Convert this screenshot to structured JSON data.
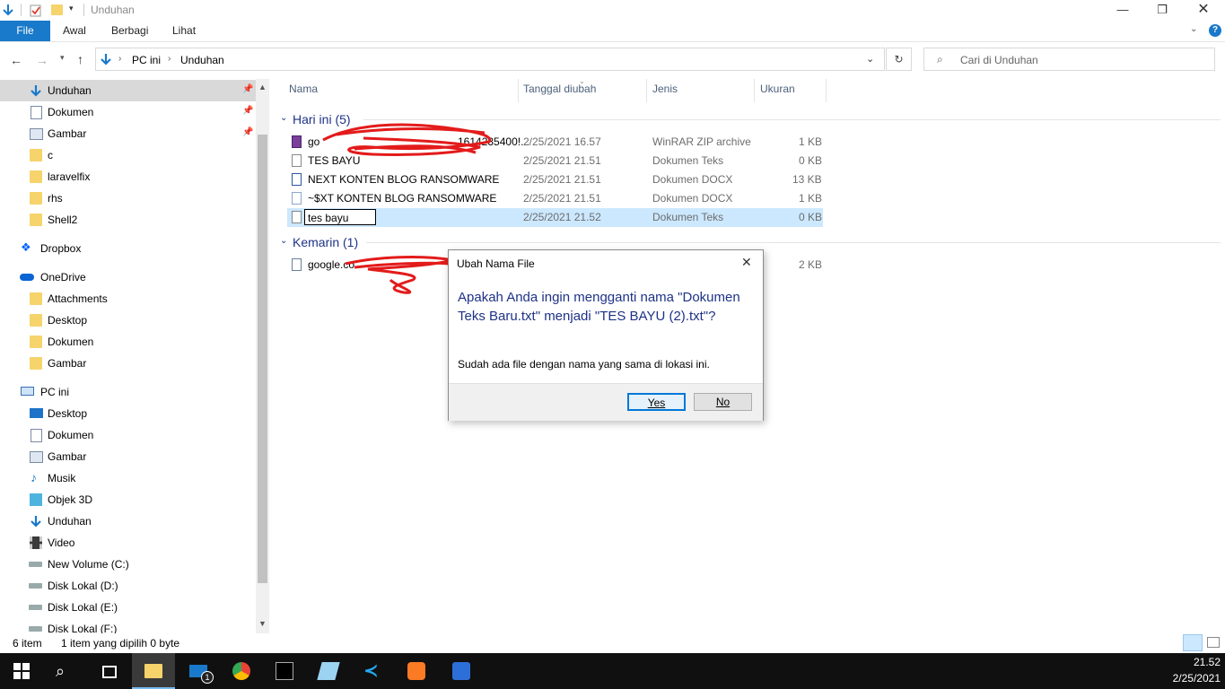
{
  "window": {
    "title": "Unduhan"
  },
  "ribbon": {
    "tabs": [
      "File",
      "Awal",
      "Berbagi",
      "Lihat"
    ]
  },
  "address": {
    "crumbs": [
      "PC ini",
      "Unduhan"
    ],
    "search_placeholder": "Cari di Unduhan"
  },
  "nav": {
    "quick_access": [
      "Unduhan",
      "Dokumen",
      "Gambar",
      "c",
      "laravelfix",
      "rhs",
      "Shell2"
    ],
    "dropbox": "Dropbox",
    "onedrive": "OneDrive",
    "onedrive_items": [
      "Attachments",
      "Desktop",
      "Dokumen",
      "Gambar"
    ],
    "pc": "PC ini",
    "pc_items": [
      "Desktop",
      "Dokumen",
      "Gambar",
      "Musik",
      "Objek 3D",
      "Unduhan",
      "Video",
      "New Volume (C:)",
      "Disk Lokal (D:)",
      "Disk Lokal (E:)",
      "Disk Lokal (F:)"
    ]
  },
  "columns": {
    "name": "Nama",
    "date": "Tanggal diubah",
    "type": "Jenis",
    "size": "Ukuran"
  },
  "groups": [
    {
      "label": "Hari ini (5)"
    },
    {
      "label": "Kemarin (1)"
    }
  ],
  "files_today": [
    {
      "name": "go",
      "name_tail": "1614235400!...",
      "date": "2/25/2021 16.57",
      "type": "WinRAR ZIP archive",
      "size": "1 KB"
    },
    {
      "name": "TES BAYU",
      "date": "2/25/2021 21.51",
      "type": "Dokumen Teks",
      "size": "0 KB"
    },
    {
      "name": "NEXT KONTEN BLOG RANSOMWARE",
      "date": "2/25/2021 21.51",
      "type": "Dokumen DOCX",
      "size": "13 KB"
    },
    {
      "name": "~$XT KONTEN BLOG RANSOMWARE",
      "date": "2/25/2021 21.51",
      "type": "Dokumen DOCX",
      "size": "1 KB"
    },
    {
      "name": "tes bayu",
      "date": "2/25/2021 21.52",
      "type": "Dokumen Teks",
      "size": "0 KB"
    }
  ],
  "files_yesterday": [
    {
      "name": "google.co",
      "size": "2 KB"
    }
  ],
  "dialog": {
    "title": "Ubah Nama File",
    "question": "Apakah Anda ingin mengganti nama \"Dokumen Teks Baru.txt\" menjadi \"TES BAYU (2).txt\"?",
    "detail": "Sudah ada file dengan nama yang sama di lokasi ini.",
    "yes": "Yes",
    "no": "No"
  },
  "status": {
    "count": "6 item",
    "selected": "1 item yang dipilih  0 byte"
  },
  "taskbar": {
    "time": "21.52",
    "date": "2/25/2021",
    "mail_badge": "1"
  },
  "colors": {
    "accent": "#1979ca",
    "selection": "#cce8ff",
    "dialog_heading": "#1e3287"
  }
}
